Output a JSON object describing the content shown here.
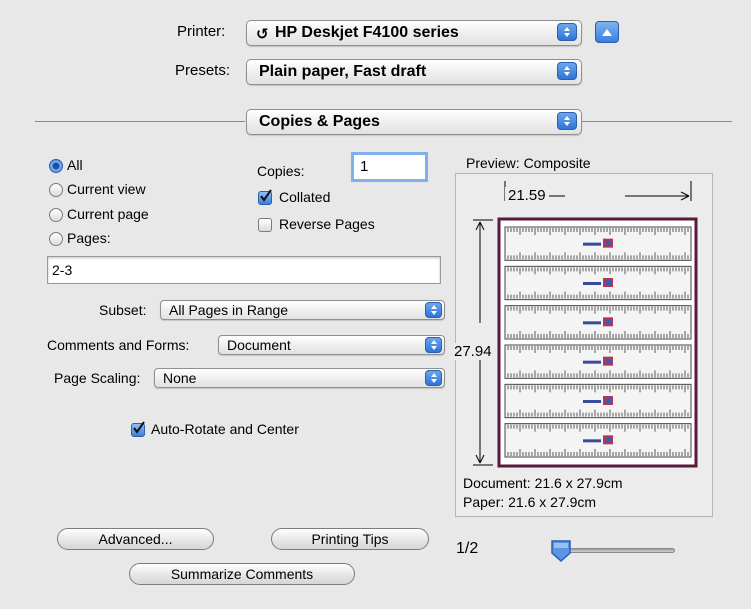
{
  "printer": {
    "label": "Printer:",
    "value": "HP Deskjet F4100 series"
  },
  "presets": {
    "label": "Presets:",
    "value": "Plain paper, Fast draft"
  },
  "panel": {
    "value": "Copies & Pages"
  },
  "range": {
    "all": "All",
    "current_view": "Current view",
    "current_page": "Current page",
    "pages": "Pages:",
    "pages_value": "2-3",
    "selected": "All"
  },
  "copies": {
    "label": "Copies:",
    "value": "1"
  },
  "collated": {
    "label": "Collated",
    "checked": true
  },
  "reverse": {
    "label": "Reverse Pages",
    "checked": false
  },
  "subset": {
    "label": "Subset:",
    "value": "All Pages in Range"
  },
  "comments": {
    "label": "Comments and Forms:",
    "value": "Document"
  },
  "scaling": {
    "label": "Page Scaling:",
    "value": "None"
  },
  "autorotate": {
    "label": "Auto-Rotate and Center",
    "checked": true
  },
  "preview": {
    "title": "Preview: Composite",
    "width_label": "21.59",
    "height_label": "27.94",
    "document": "Document: 21.6 x 27.9cm",
    "paper": "Paper: 21.6 x 27.9cm",
    "page_indicator": "1/2",
    "rows": 6
  },
  "buttons": {
    "advanced": "Advanced...",
    "printing_tips": "Printing Tips",
    "summarize": "Summarize Comments"
  },
  "colors": {
    "accent": "#3a7fdc",
    "page_border": "#5a1a3a"
  }
}
